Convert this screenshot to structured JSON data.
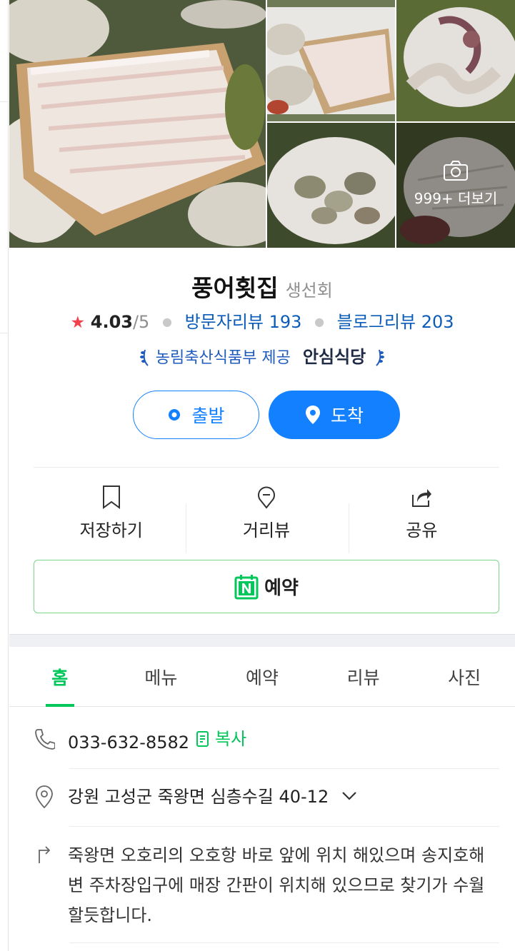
{
  "photos": {
    "more_label": "999+ 더보기",
    "camera_icon": "camera-icon"
  },
  "place": {
    "name": "풍어횟집",
    "category": "생선회"
  },
  "rating": {
    "star_icon": "★",
    "score": "4.03",
    "max": "/5",
    "visitor_reviews_label": "방문자리뷰 193",
    "blog_reviews_label": "블로그리뷰 203"
  },
  "badge": {
    "provider": "농림축산식품부 제공",
    "brand": "안심식당"
  },
  "route": {
    "depart_label": "출발",
    "arrive_label": "도착"
  },
  "actions": [
    {
      "label": "저장하기",
      "icon": "bookmark-icon"
    },
    {
      "label": "거리뷰",
      "icon": "street-view-icon"
    },
    {
      "label": "공유",
      "icon": "share-icon"
    }
  ],
  "reserve": {
    "label": "예약",
    "icon": "naver-booking-icon"
  },
  "tabs": [
    {
      "label": "홈",
      "active": true
    },
    {
      "label": "메뉴",
      "active": false
    },
    {
      "label": "예약",
      "active": false
    },
    {
      "label": "리뷰",
      "active": false
    },
    {
      "label": "사진",
      "active": false
    }
  ],
  "details": {
    "phone": "033-632-8582",
    "copy_label": "복사",
    "address": "강원 고성군 죽왕면 심층수길 40-12",
    "directions": "죽왕면 오호리의 오호항 바로 앞에 위치 해있으며 송지호해변 주차장입구에 매장 간판이 위치해 있으므로 찾기가 수월할듯합니다."
  },
  "colors": {
    "accent_blue": "#1380ff",
    "link_blue": "#0b5cb8",
    "naver_green": "#03c75a",
    "star_red": "#f2414c"
  }
}
